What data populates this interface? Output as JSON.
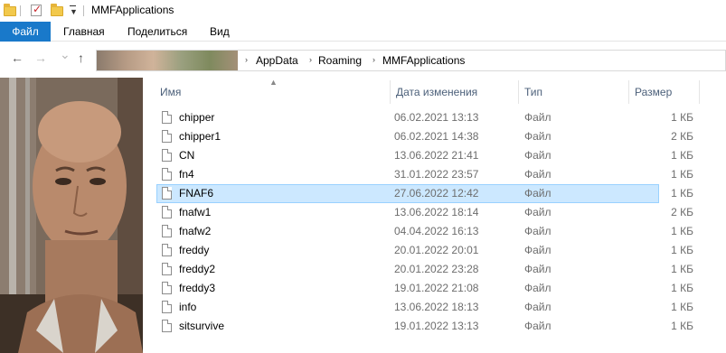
{
  "window": {
    "title": "MMFApplications",
    "icons": [
      "folder-icon",
      "properties-check-icon",
      "new-folder-icon",
      "quick-access-dropdown-icon"
    ]
  },
  "ribbon": {
    "tabs": [
      {
        "label": "Файл",
        "active": true
      },
      {
        "label": "Главная"
      },
      {
        "label": "Поделиться"
      },
      {
        "label": "Вид"
      }
    ]
  },
  "nav": {
    "back": "←",
    "forward": "→",
    "recent": "⌄",
    "up": "↑",
    "breadcrumbs": [
      "AppData",
      "Roaming",
      "MMFApplications"
    ],
    "separator": "›"
  },
  "columns": {
    "name": "Имя",
    "date": "Дата изменения",
    "type": "Тип",
    "size": "Размер"
  },
  "files": [
    {
      "name": "chipper",
      "date": "06.02.2021 13:13",
      "type": "Файл",
      "size": "1 КБ"
    },
    {
      "name": "chipper1",
      "date": "06.02.2021 14:38",
      "type": "Файл",
      "size": "2 КБ"
    },
    {
      "name": "CN",
      "date": "13.06.2022 21:41",
      "type": "Файл",
      "size": "1 КБ"
    },
    {
      "name": "fn4",
      "date": "31.01.2022 23:57",
      "type": "Файл",
      "size": "1 КБ"
    },
    {
      "name": "FNAF6",
      "date": "27.06.2022 12:42",
      "type": "Файл",
      "size": "1 КБ",
      "selected": true
    },
    {
      "name": "fnafw1",
      "date": "13.06.2022 18:14",
      "type": "Файл",
      "size": "2 КБ"
    },
    {
      "name": "fnafw2",
      "date": "04.04.2022 16:13",
      "type": "Файл",
      "size": "1 КБ"
    },
    {
      "name": "freddy",
      "date": "20.01.2022 20:01",
      "type": "Файл",
      "size": "1 КБ"
    },
    {
      "name": "freddy2",
      "date": "20.01.2022 23:28",
      "type": "Файл",
      "size": "1 КБ"
    },
    {
      "name": "freddy3",
      "date": "19.01.2022 21:08",
      "type": "Файл",
      "size": "1 КБ"
    },
    {
      "name": "info",
      "date": "13.06.2022 18:13",
      "type": "Файл",
      "size": "1 КБ"
    },
    {
      "name": "sitsurvive",
      "date": "19.01.2022 13:13",
      "type": "Файл",
      "size": "1 КБ"
    }
  ],
  "colors": {
    "file_tab": "#1979ca",
    "selection": "#cce8ff",
    "header_text": "#4c607a"
  }
}
